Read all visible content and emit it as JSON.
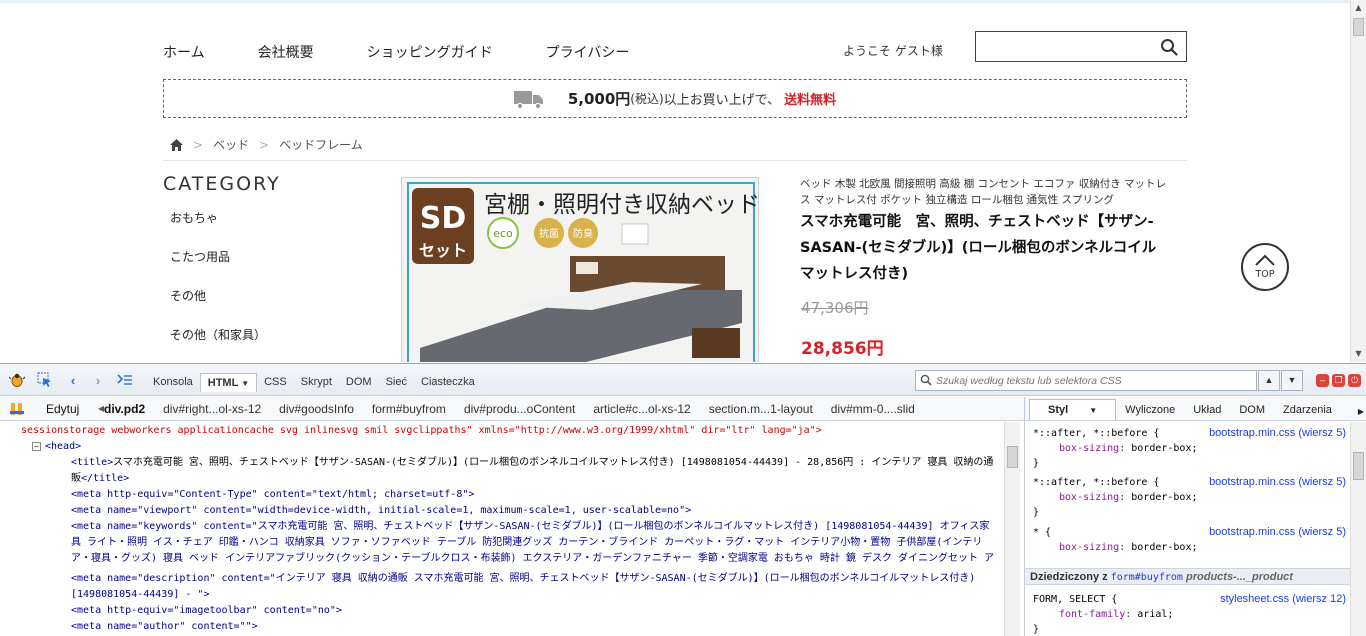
{
  "site": {
    "nav": [
      "ホーム",
      "会社概要",
      "ショッピングガイド",
      "プライバシー"
    ],
    "welcome": "ようこそ ゲスト様",
    "search_placeholder": "",
    "shipping": {
      "amount": "5,000円",
      "tax": "(税込)",
      "text": " 以上お買い上げで、",
      "free": "送料無料"
    },
    "breadcrumb": [
      "ベッド",
      "ベッドフレーム"
    ],
    "category_title": "CATEGORY",
    "categories": [
      "おもちゃ",
      "こたつ用品",
      "その他",
      "その他（和家具）"
    ],
    "product": {
      "subtitle": "ベッド 木製 北欧風 間接照明 高級 棚 コンセント エコファ 収納付き マットレス マットレス付 ポケット 独立構造 ロール梱包 通気性 スプリング",
      "title": "スマホ充電可能　宮、照明、チェストベッド【サザン-SASAN-(セミダブル)】(ロール梱包のボンネルコイルマットレス付き)",
      "old_price": "47,306円",
      "price": "28,856円",
      "image": {
        "badge_top": "SD",
        "badge_bottom": "セット",
        "headline": "宮棚・照明付き収納ベッド",
        "eco": "eco",
        "tag1": "抗菌",
        "tag2": "防臭"
      }
    },
    "top_button": "TOP"
  },
  "firebug": {
    "tabs": [
      "Konsola",
      "HTML",
      "CSS",
      "Skrypt",
      "DOM",
      "Sieć",
      "Ciasteczka"
    ],
    "active_tab": "HTML",
    "search_placeholder": "Szukaj według tekstu lub selektora CSS",
    "edit_label": "Edytuj",
    "breadcrumb": [
      "div.pd2",
      "div#right...ol-xs-12",
      "div#goodsInfo",
      "form#buyfrom",
      "div#produ...oContent",
      "article#c...ol-xs-12",
      "section.m...1-layout",
      "div#mm-0....slid"
    ],
    "html": {
      "line0": "sessionstorage webworkers applicationcache svg inlinesvg smil svgclippaths\" xmlns=\"http://www.w3.org/1999/xhtml\" dir=\"ltr\" lang=\"ja\">",
      "head": "<head>",
      "title_open": "<title>",
      "title_text": "スマホ充電可能 宮、照明、チェストベッド【サザン-SASAN-(セミダブル)】(ロール梱包のボンネルコイルマットレス付き) [1498081054-44439] - 28,856円 : インテリア 寝具 収納の通販",
      "title_close": "</title>",
      "meta1": "<meta http-equiv=\"Content-Type\" content=\"text/html; charset=utf-8\">",
      "meta2": "<meta name=\"viewport\" content=\"width=device-width, initial-scale=1, maximum-scale=1, user-scalable=no\">",
      "meta3": "<meta name=\"keywords\" content=\"スマホ充電可能 宮、照明、チェストベッド【サザン-SASAN-(セミダブル)】(ロール梱包のボンネルコイルマットレス付き) [1498081054-44439] オフィス家具 ライト・照明 イス・チェア 印鑑・ハンコ 収納家具 ソファ・ソファベッド テーブル 防犯関連グッズ カーテン・ブラインド カーペット・ラグ・マット インテリア小物・置物 子供部屋(インテリア・寝具・グッズ) 寝具 ベッド インテリアファブリック(クッション・テーブルクロス・布装飾) エクステリア・ガーデンファニチャー 季節・空調家電 おもちゃ 時計 鏡 デスク ダイニングセット アクセサリー・部品 その他(和家具) 文房具・事務用品 仏壇・仏具・神具 福祉・介護 こたつ用品 アート・美術品・骨董品・民芸品 その他 \">",
      "meta4": "<meta name=\"description\" content=\"インテリア 寝具 収納の通販 スマホ充電可能 宮、照明、チェストベッド【サザン-SASAN-(セミダブル)】(ロール梱包のボンネルコイルマットレス付き) [1498081054-44439] - \">",
      "meta5": "<meta http-equiv=\"imagetoolbar\" content=\"no\">",
      "meta6": "<meta name=\"author\" content=\"\">"
    },
    "side_tabs": [
      "Styl",
      "Wyliczone",
      "Układ",
      "DOM",
      "Zdarzenia"
    ],
    "rules": [
      {
        "selector": "*::after, *::before {",
        "prop": "box-sizing",
        "value": "border-box;",
        "source": "bootstrap.min.css (wiersz 5)"
      },
      {
        "selector": "*::after, *::before {",
        "prop": "box-sizing",
        "value": "border-box;",
        "source": "bootstrap.min.css (wiersz 5)"
      },
      {
        "selector": "* {",
        "prop": "box-sizing",
        "value": "border-box;",
        "source": "bootstrap.min.css (wiersz 5)"
      }
    ],
    "inherited": {
      "label": "Dziedziczony z",
      "element": "form#buyfrom",
      "path": "products-..._product"
    },
    "rule4": {
      "selector": "FORM, SELECT {",
      "prop": "font-family",
      "value": "arial;",
      "source": "stylesheet.css (wiersz 12)"
    },
    "close_brace": "}"
  }
}
